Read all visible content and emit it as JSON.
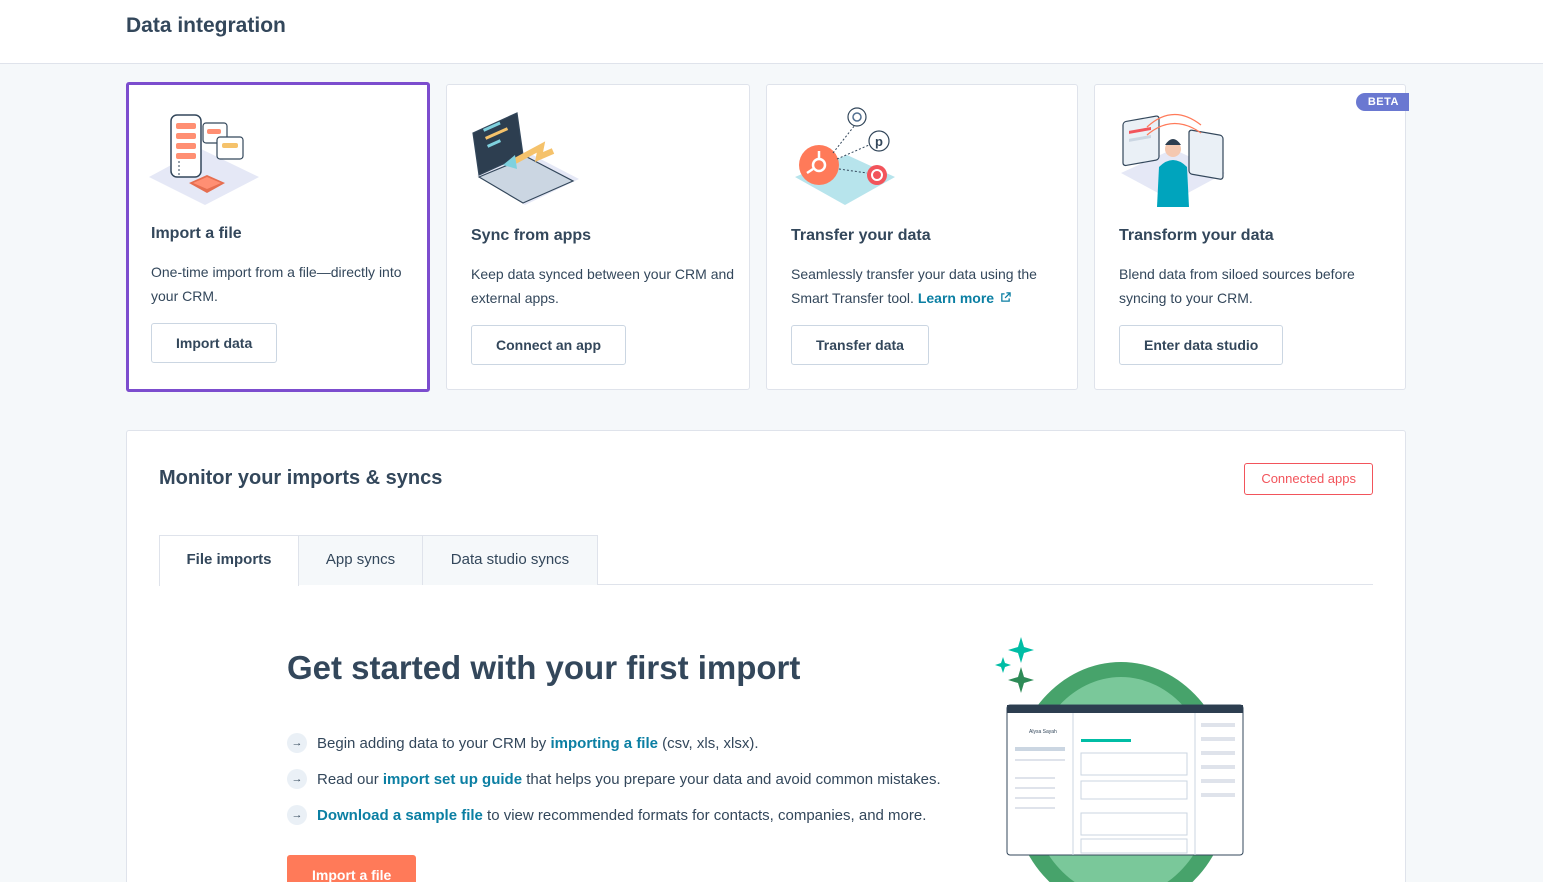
{
  "header": {
    "title": "Data integration"
  },
  "cards": [
    {
      "title": "Import a file",
      "desc": "One-time import from a file—directly into your CRM.",
      "button": "Import data",
      "illustration": "import-file-illustration"
    },
    {
      "title": "Sync from apps",
      "desc": "Keep data synced between your CRM and external apps.",
      "button": "Connect an app",
      "illustration": "sync-apps-illustration"
    },
    {
      "title": "Transfer your data",
      "desc_prefix": "Seamlessly transfer your data using the Smart Transfer tool.",
      "link": "Learn more",
      "button": "Transfer data",
      "illustration": "transfer-data-illustration",
      "link_icon": "external-link-icon"
    },
    {
      "title": "Transform your data",
      "desc": "Blend data from siloed sources before syncing to your CRM.",
      "button": "Enter data studio",
      "badge": "BETA",
      "illustration": "transform-data-illustration"
    }
  ],
  "monitor": {
    "title": "Monitor your imports & syncs",
    "connected_apps": "Connected apps",
    "tabs": [
      "File imports",
      "App syncs",
      "Data studio syncs"
    ],
    "active_tab": "File imports",
    "get_started": {
      "title": "Get started with your first import",
      "items": [
        {
          "pre": "Begin adding data to your CRM by ",
          "link": "importing a file",
          "post": " (csv, xls, xlsx)."
        },
        {
          "pre": "Read our ",
          "link": "import set up guide",
          "post": " that helps you prepare your data and avoid common mistakes."
        },
        {
          "pre": "",
          "link": "Download a sample file",
          "post": " to view recommended formats for contacts, companies, and more."
        }
      ],
      "button": "Import a file"
    },
    "hero_contact_name": "Alysa Sayah"
  },
  "colors": {
    "accent": "#7c4dce",
    "primary": "#ff7a59",
    "link": "#0b7fa3",
    "badge": "#6a78d1",
    "text": "#33475b"
  }
}
